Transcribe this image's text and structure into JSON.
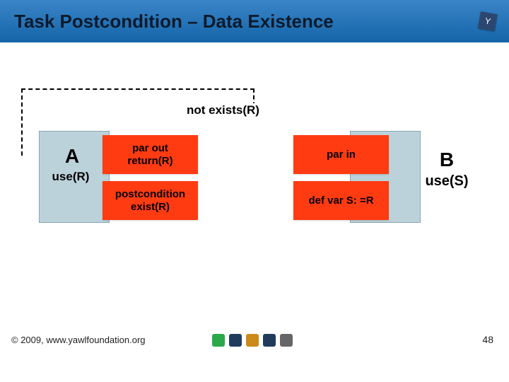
{
  "header": {
    "title": "Task Postcondition – Data Existence"
  },
  "diagram": {
    "not_exists_label": "not exists(R)",
    "task_a": {
      "name": "A",
      "sub": "use(R)"
    },
    "left_red": {
      "top": "par out\nreturn(R)",
      "bottom": "postcondition\nexist(R)"
    },
    "right_red": {
      "top": "par in",
      "bottom": "def var S: =R"
    },
    "task_b": {
      "name": "B",
      "sub": "use(S)"
    }
  },
  "footer": {
    "copyright": "© 2009, www.yawlfoundation.org",
    "page": "48"
  }
}
